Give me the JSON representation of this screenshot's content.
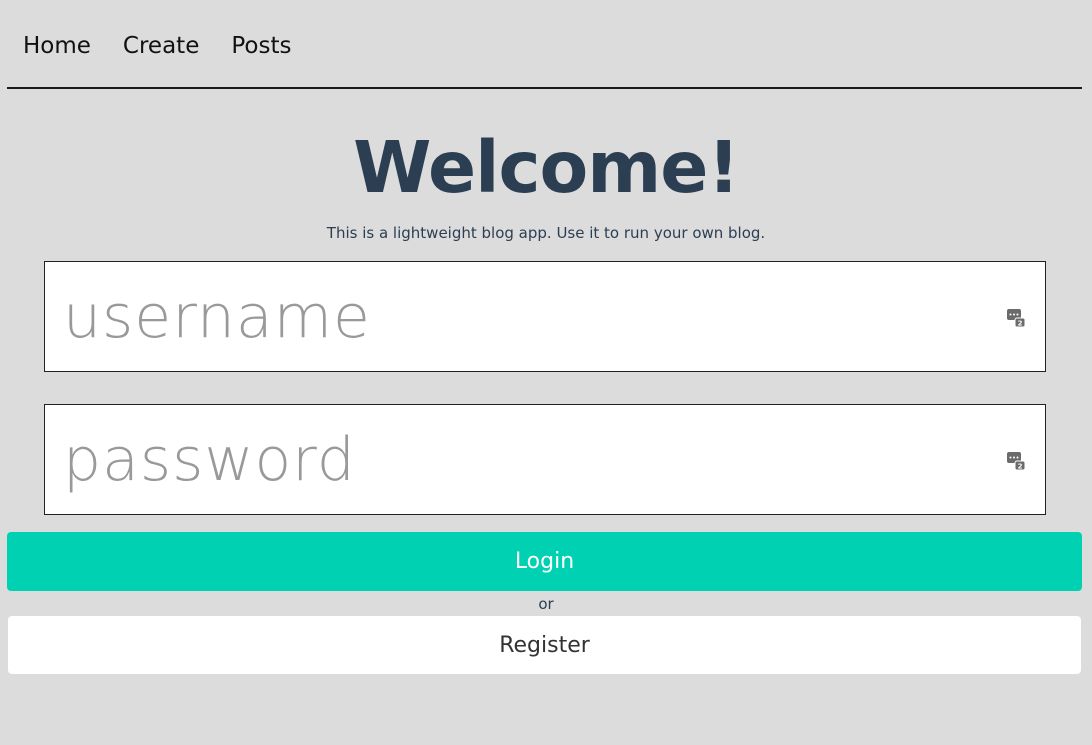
{
  "nav": {
    "items": [
      {
        "label": "Home"
      },
      {
        "label": "Create"
      },
      {
        "label": "Posts"
      }
    ]
  },
  "hero": {
    "title": "Welcome!",
    "subtitle": "This is a lightweight blog app. Use it to run your own blog."
  },
  "form": {
    "username": {
      "placeholder": "username",
      "value": "",
      "icon": "password-manager-icon"
    },
    "password": {
      "placeholder": "password",
      "value": "",
      "icon": "password-manager-icon"
    },
    "login_label": "Login",
    "or_label": "or",
    "register_label": "Register"
  },
  "colors": {
    "background": "#dcdcdc",
    "title": "#2c3e52",
    "primary": "#00d1b2",
    "white": "#ffffff"
  }
}
